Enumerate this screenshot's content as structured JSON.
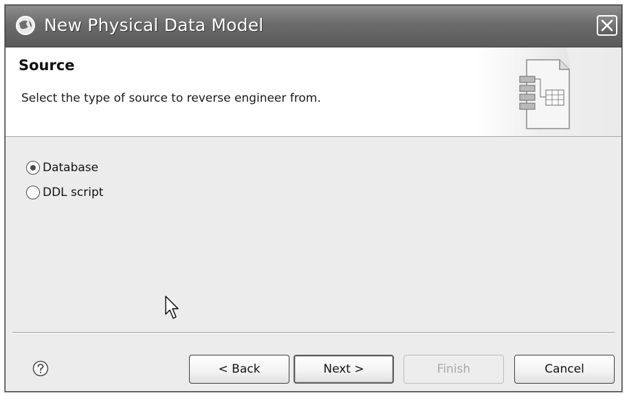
{
  "window": {
    "title": "New Physical Data Model",
    "close_label": "Close",
    "icons": {
      "app": "app-globe-icon",
      "close": "close-icon"
    }
  },
  "header": {
    "title": "Source",
    "description": "Select the type of source to reverse engineer from.",
    "banner_icon": "data-model-wizard-icon"
  },
  "source_options": [
    {
      "label": "Database",
      "selected": true
    },
    {
      "label": "DDL script",
      "selected": false
    }
  ],
  "footer": {
    "help_icon": "help-icon",
    "buttons": {
      "back": "< Back",
      "next": "Next >",
      "finish": "Finish",
      "cancel": "Cancel"
    },
    "finish_enabled": false
  },
  "colors": {
    "titlebar": "#6b6b6b",
    "dialog_bg": "#ececec",
    "header_bg": "#ffffff",
    "disabled_text": "#a8a8a8"
  }
}
